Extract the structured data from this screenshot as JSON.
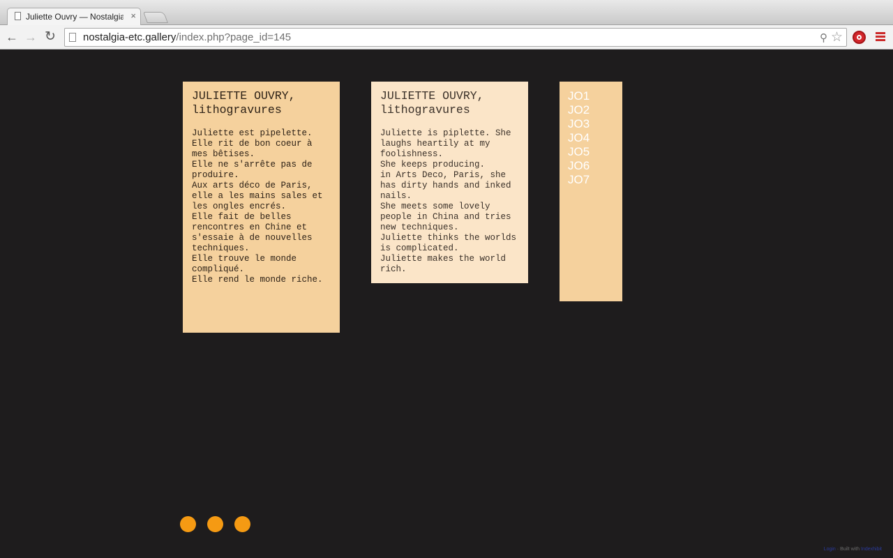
{
  "browser": {
    "tab_title": "Juliette Ouvry — Nostalgia",
    "tab_close": "×",
    "url_domain": "nostalgia-etc.gallery",
    "url_path": "/index.php?page_id=145"
  },
  "cards": {
    "french": {
      "title": "JULIETTE OUVRY,\nlithogravures",
      "text": "Juliette est pipelette.\nElle rit de bon coeur à mes bêtises.\nElle ne s'arrête pas de produire.\nAux arts déco de Paris, elle a les mains sales et les ongles encrés.\nElle fait de belles rencontres en Chine et s'essaie à de nouvelles techniques.\nElle trouve le monde compliqué.\nElle rend le monde riche."
    },
    "english": {
      "title": "JULIETTE OUVRY,\nlithogravures",
      "text": "Juliette is piplette. She laughs heartily at my foolishness.\nShe keeps producing.\nin Arts Deco, Paris, she has dirty hands and inked nails.\nShe meets some lovely people in China and tries new techniques.\nJuliette thinks the worlds is complicated.\nJuliette makes the world rich."
    }
  },
  "works": {
    "items": [
      "JO1",
      "JO2",
      "JO3",
      "JO4",
      "JO5",
      "JO6",
      "JO7"
    ]
  },
  "footer": {
    "left_link": "Login",
    "separator": "·",
    "built_with": "Built with",
    "right_link": "Indexhibit"
  },
  "colors": {
    "background": "#1e1c1d",
    "card_orange": "#f5d19d",
    "card_light": "#fbe5c8",
    "dot": "#f59a13"
  }
}
